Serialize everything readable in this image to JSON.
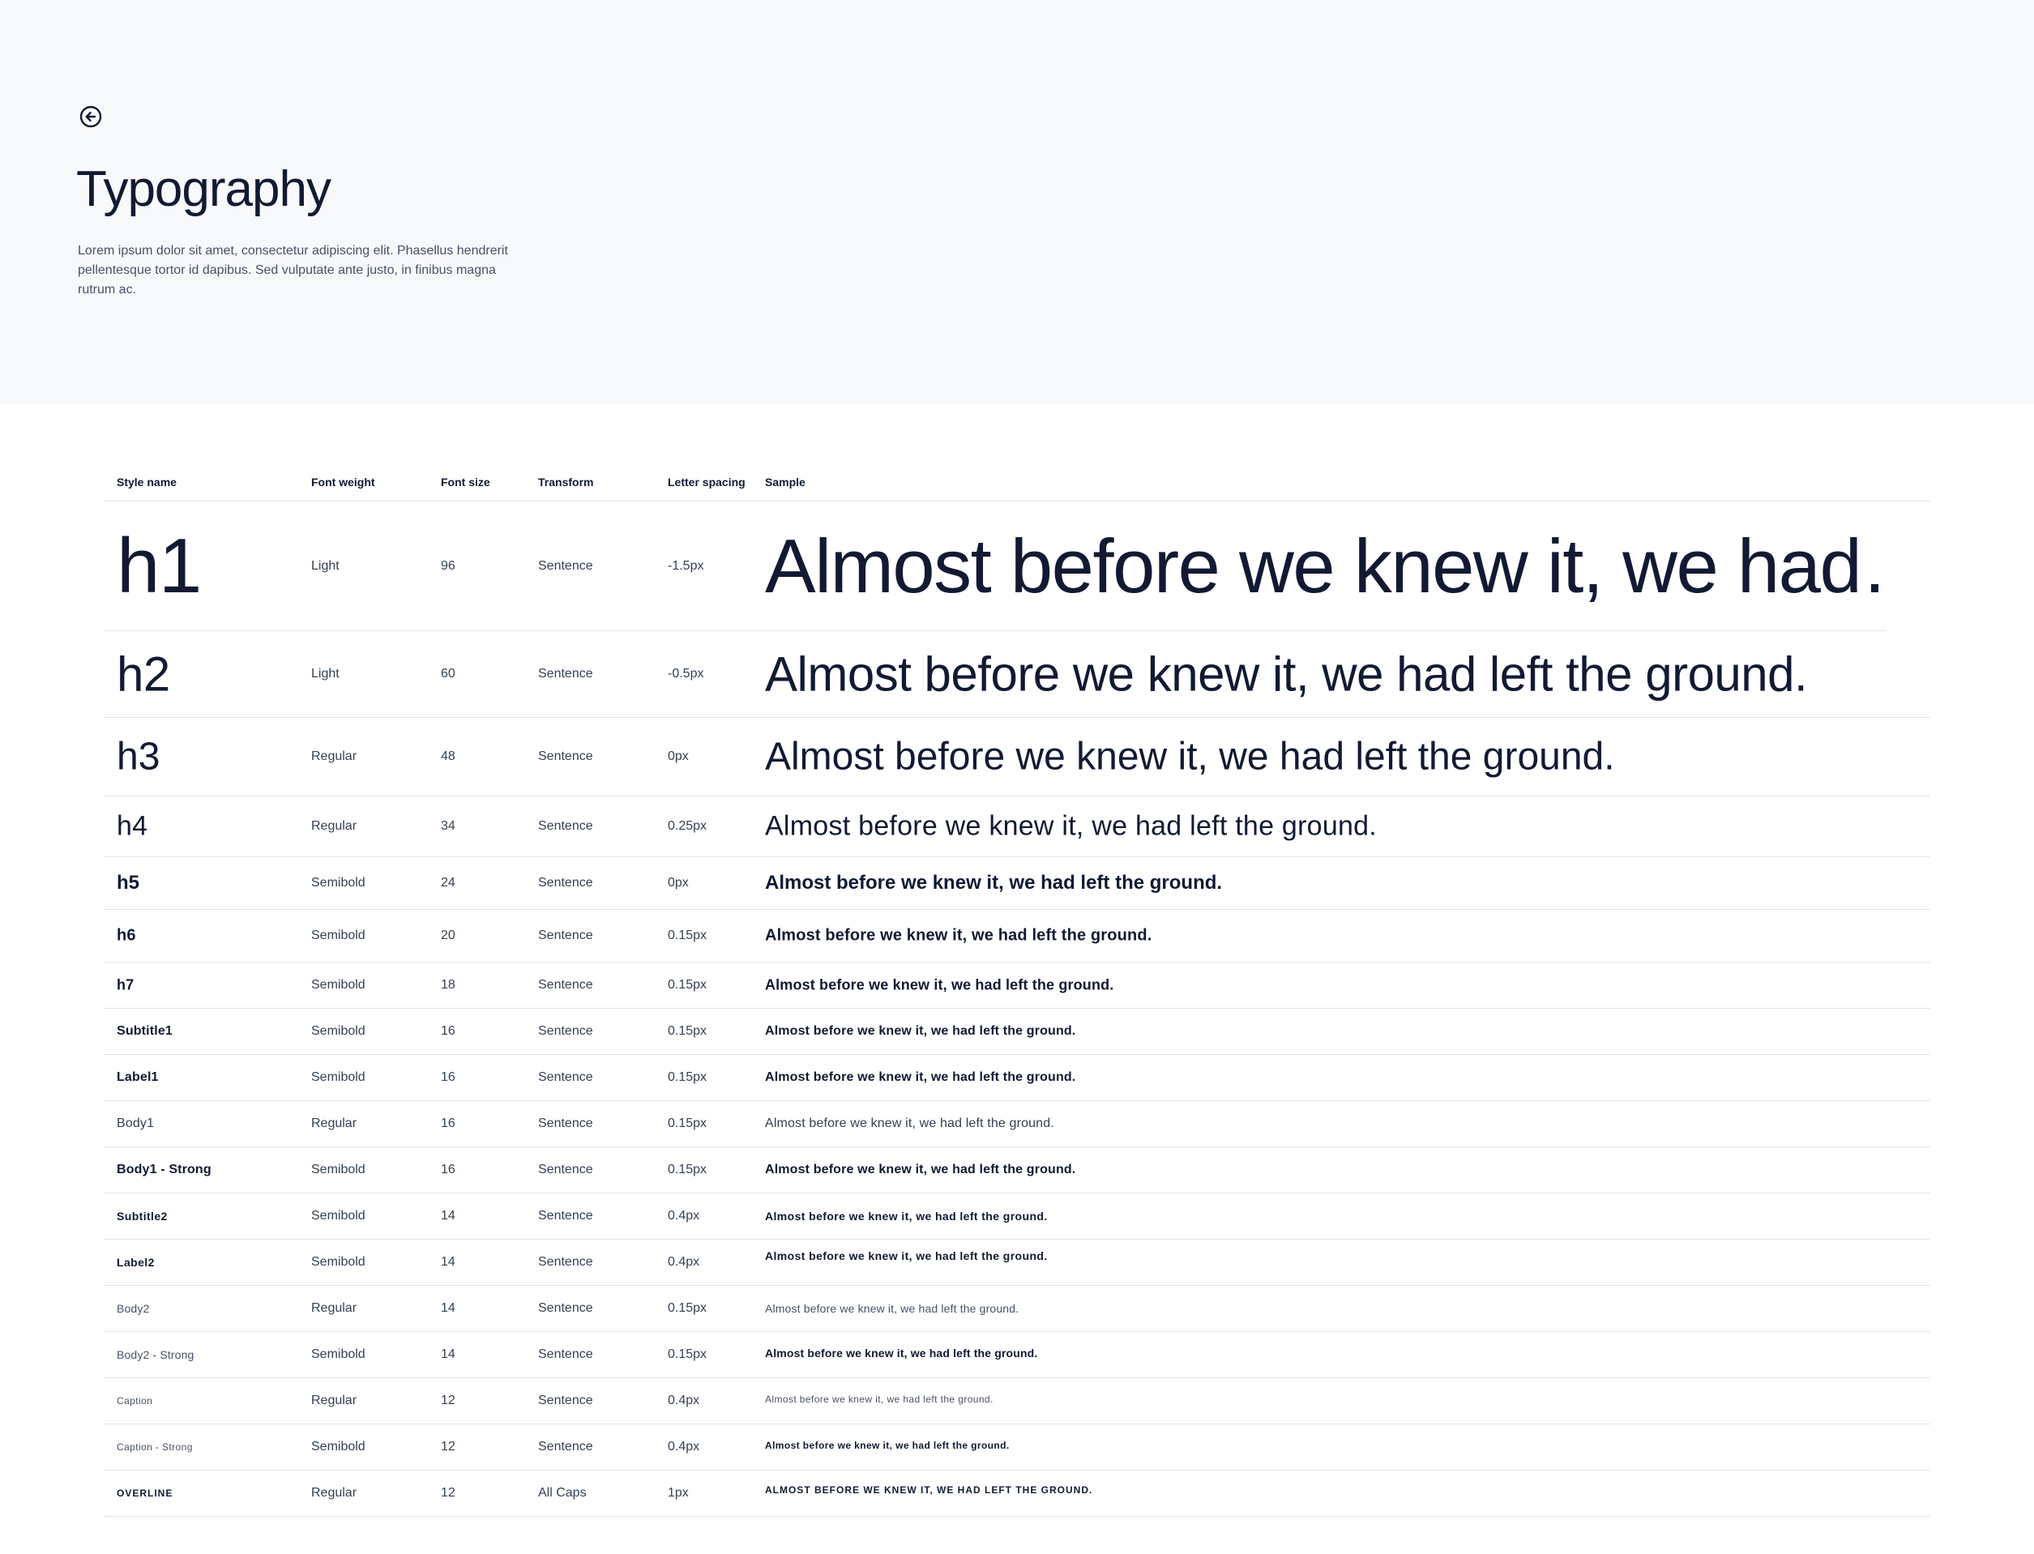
{
  "header": {
    "back_icon": "arrow-left-circle-icon",
    "title": "Typography",
    "description": "Lorem ipsum dolor sit amet, consectetur adipiscing elit. Phasellus hendrerit pellentesque tortor id dapibus. Sed vulputate ante justo, in finibus magna rutrum ac."
  },
  "table": {
    "columns": [
      "Style name",
      "Font weight",
      "Font size",
      "Transform",
      "Letter spacing",
      "Sample"
    ],
    "rows": [
      {
        "name": "h1",
        "weight": "Light",
        "size": "96",
        "transform": "Sentence",
        "spacing": "-1.5px",
        "sample": "Almost before we knew it, we had…"
      },
      {
        "name": "h2",
        "weight": "Light",
        "size": "60",
        "transform": "Sentence",
        "spacing": "-0.5px",
        "sample": "Almost before we knew it, we had left the ground."
      },
      {
        "name": "h3",
        "weight": "Regular",
        "size": "48",
        "transform": "Sentence",
        "spacing": "0px",
        "sample": "Almost before we knew it, we had left the ground."
      },
      {
        "name": "h4",
        "weight": "Regular",
        "size": "34",
        "transform": "Sentence",
        "spacing": "0.25px",
        "sample": "Almost before we knew it, we had left the ground."
      },
      {
        "name": "h5",
        "weight": "Semibold",
        "size": "24",
        "transform": "Sentence",
        "spacing": "0px",
        "sample": "Almost before we knew it, we had left the ground."
      },
      {
        "name": "h6",
        "weight": "Semibold",
        "size": "20",
        "transform": "Sentence",
        "spacing": "0.15px",
        "sample": "Almost before we knew it, we had left the ground."
      },
      {
        "name": "h7",
        "weight": "Semibold",
        "size": "18",
        "transform": "Sentence",
        "spacing": "0.15px",
        "sample": "Almost before we knew it, we had left the ground."
      },
      {
        "name": "Subtitle1",
        "weight": "Semibold",
        "size": "16",
        "transform": "Sentence",
        "spacing": "0.15px",
        "sample": "Almost before we knew it, we had left the ground."
      },
      {
        "name": "Label1",
        "weight": "Semibold",
        "size": "16",
        "transform": "Sentence",
        "spacing": "0.15px",
        "sample": "Almost before we knew it, we had left the ground."
      },
      {
        "name": "Body1",
        "weight": "Regular",
        "size": "16",
        "transform": "Sentence",
        "spacing": "0.15px",
        "sample": "Almost before we knew it, we had left the ground."
      },
      {
        "name": "Body1 - Strong",
        "weight": "Semibold",
        "size": "16",
        "transform": "Sentence",
        "spacing": "0.15px",
        "sample": "Almost before we knew it, we had left the ground."
      },
      {
        "name": "Subtitle2",
        "weight": "Semibold",
        "size": "14",
        "transform": "Sentence",
        "spacing": "0.4px",
        "sample": "Almost before we knew it, we had left the ground."
      },
      {
        "name": "Label2",
        "weight": "Semibold",
        "size": "14",
        "transform": "Sentence",
        "spacing": "0.4px",
        "sample": "Almost before we knew it, we had left the ground."
      },
      {
        "name": "Body2",
        "weight": "Regular",
        "size": "14",
        "transform": "Sentence",
        "spacing": "0.15px",
        "sample": "Almost before we knew it, we had left the ground."
      },
      {
        "name": "Body2 - Strong",
        "weight": "Semibold",
        "size": "14",
        "transform": "Sentence",
        "spacing": "0.15px",
        "sample": "Almost before we knew it, we had left the ground."
      },
      {
        "name": "Caption",
        "weight": "Regular",
        "size": "12",
        "transform": "Sentence",
        "spacing": "0.4px",
        "sample": "Almost before we knew it, we had left the ground."
      },
      {
        "name": "Caption - Strong",
        "weight": "Semibold",
        "size": "12",
        "transform": "Sentence",
        "spacing": "0.4px",
        "sample": "Almost before we knew it, we had left the ground."
      },
      {
        "name": "OVERLINE",
        "weight": "Regular",
        "size": "12",
        "transform": "All Caps",
        "spacing": "1px",
        "sample": "ALMOST BEFORE WE KNEW IT, WE HAD LEFT THE GROUND."
      }
    ]
  }
}
